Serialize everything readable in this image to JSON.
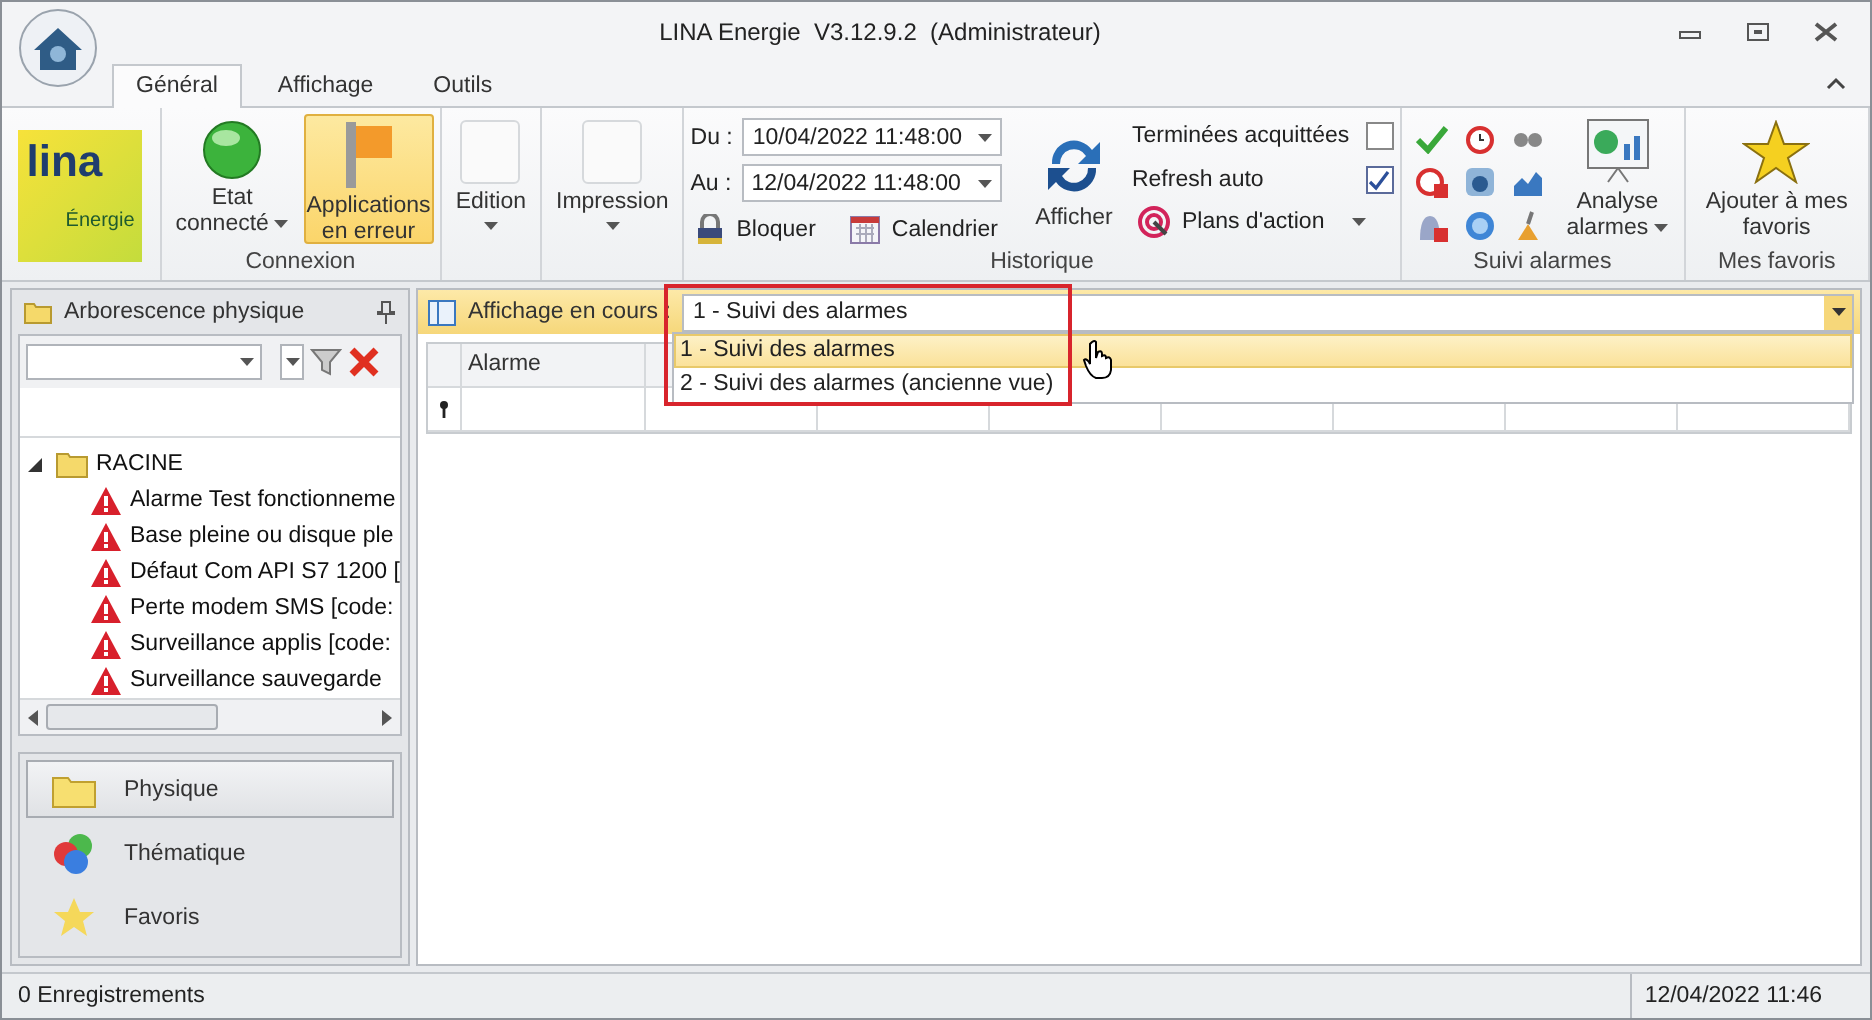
{
  "window": {
    "title": "LINA Energie  V3.12.9.2  (Administrateur)"
  },
  "tabs": [
    {
      "label": "Général",
      "selected": true
    },
    {
      "label": "Affichage",
      "selected": false
    },
    {
      "label": "Outils",
      "selected": false
    }
  ],
  "ribbon": {
    "logo": {
      "name": "lina",
      "sub": "Énergie"
    },
    "connexion": {
      "label": "Connexion",
      "buttons": [
        {
          "kind": "status",
          "label": "Etat connecté",
          "dropdown": true,
          "selected": false
        },
        {
          "kind": "flag",
          "label": "Applications en erreur",
          "dropdown": false,
          "selected": true
        }
      ]
    },
    "edition": {
      "label": "Edition",
      "dropdown": true
    },
    "impression": {
      "label": "Impression",
      "dropdown": true
    },
    "historique": {
      "label": "Historique",
      "from_label": "Du :",
      "from": "10/04/2022 11:48:00",
      "to_label": "Au :",
      "to": "12/04/2022 11:48:00",
      "lock": "Bloquer",
      "calendar": "Calendrier",
      "show": "Afficher",
      "options": [
        {
          "label": "Terminées acquittées",
          "checked": false
        },
        {
          "label": "Refresh auto",
          "checked": true
        }
      ],
      "plans": "Plans d'action"
    },
    "suivi": {
      "label": "Suivi alarmes",
      "analyse": "Analyse alarmes"
    },
    "favoris": {
      "label": "Mes favoris",
      "add": "Ajouter à mes favoris"
    }
  },
  "panel": {
    "title": "Arborescence physique",
    "tree": [
      {
        "label": "RACINE",
        "expanded": true,
        "children": [
          {
            "label": "Alarme Test fonctionneme"
          },
          {
            "label": "Base pleine ou disque ple"
          },
          {
            "label": "Défaut Com API S7 1200 ["
          },
          {
            "label": "Perte modem SMS [code:"
          },
          {
            "label": "Surveillance applis [code:"
          },
          {
            "label": "Surveillance sauvegarde"
          }
        ]
      }
    ],
    "nav": [
      {
        "kind": "folder",
        "label": "Physique",
        "selected": true
      },
      {
        "kind": "circles",
        "label": "Thématique",
        "selected": false
      },
      {
        "kind": "star",
        "label": "Favoris",
        "selected": false
      }
    ]
  },
  "view": {
    "label": "Affichage en cours :",
    "value": "1 - Suivi des alarmes",
    "options": [
      {
        "label": "1 - Suivi des alarmes",
        "selected": true
      },
      {
        "label": "2 - Suivi des alarmes (ancienne vue)",
        "selected": false
      }
    ]
  },
  "grid": {
    "columns": [
      "Alarme"
    ]
  },
  "status_bar": {
    "records": "0 Enregistrements",
    "datetime": "12/04/2022 11:46"
  }
}
